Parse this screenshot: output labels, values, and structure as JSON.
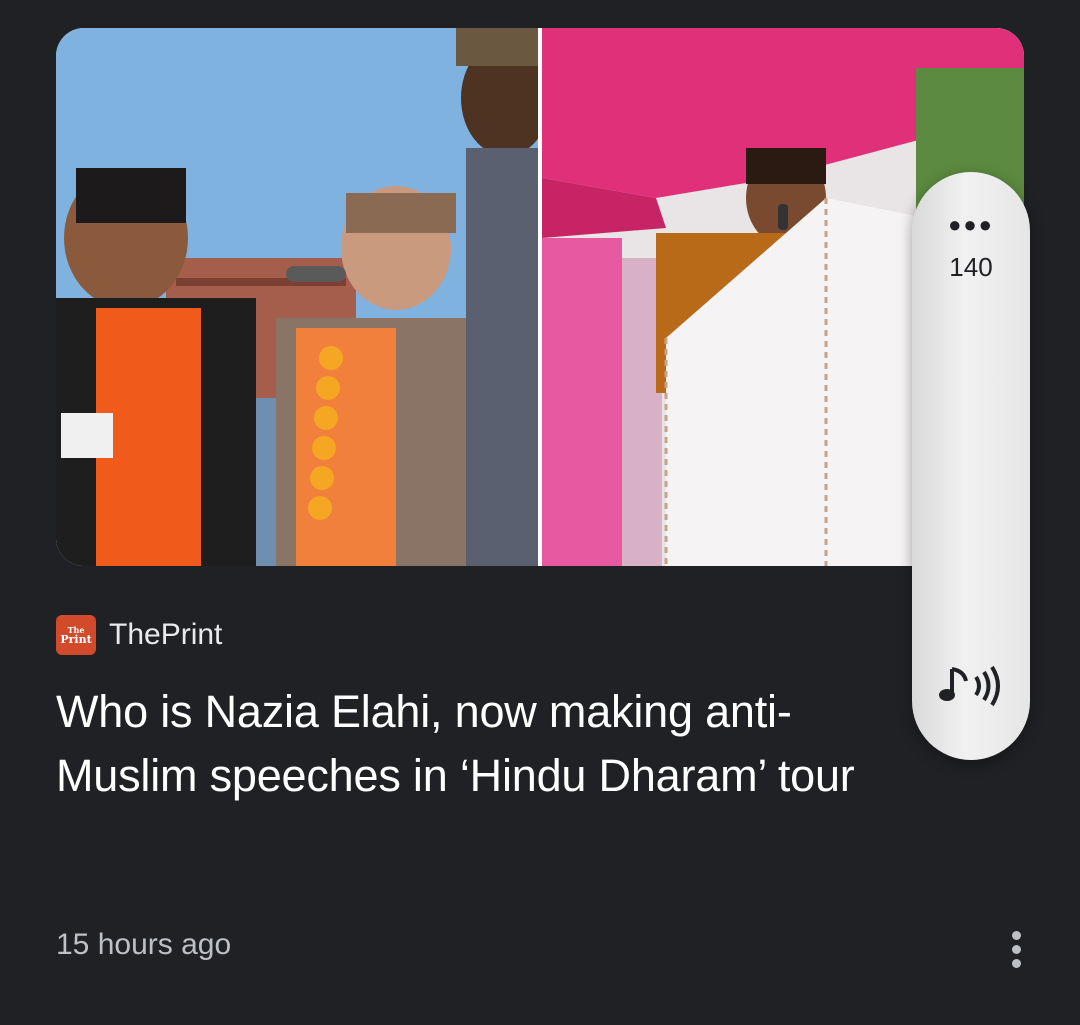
{
  "article": {
    "source_name": "ThePrint",
    "source_logo_text_top": "The",
    "source_logo_text_bottom": "Print",
    "headline": "Who is Nazia Elahi, now making anti-Muslim speeches in ‘Hindu Dharam’ tour",
    "timestamp": "15 hours ago"
  },
  "overlay": {
    "count": "140",
    "menu_icon": "more-horizontal-icon",
    "audio_icon": "music-note-sound-icon"
  },
  "colors": {
    "background": "#202124",
    "headline": "#ffffff",
    "secondary_text": "#bdc1c6",
    "logo": "#d14a2b"
  }
}
